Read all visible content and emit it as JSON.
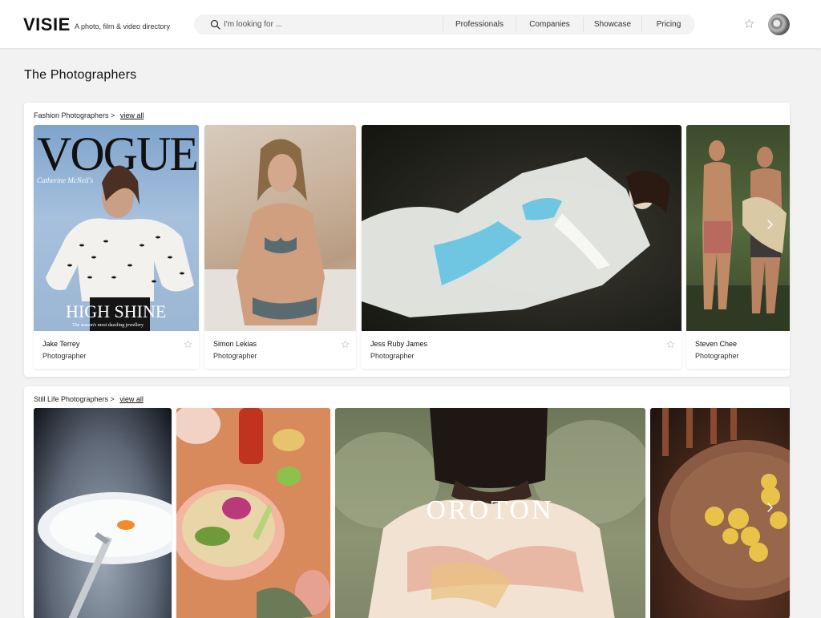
{
  "header": {
    "logo": "VISIE",
    "tagline": "A photo, film & video directory",
    "search_placeholder": "I'm looking for ...",
    "nav": [
      "Professionals",
      "Companies",
      "Showcase",
      "Pricing"
    ]
  },
  "page_title": "The Photographers",
  "sections": [
    {
      "heading": "Fashion Photographers >",
      "link": "view all",
      "cards": [
        {
          "name": "Jake Terrey",
          "role": "Photographer",
          "image_text": {
            "masthead": "VOGUE",
            "headline": "HIGH SHINE",
            "subline": "The season's most dazzling jewellery",
            "cover_name": "Catherine McNeil's"
          }
        },
        {
          "name": "Simon Lekias",
          "role": "Photographer"
        },
        {
          "name": "Jess Ruby James",
          "role": "Photographer"
        },
        {
          "name": "Steven Chee",
          "role": "Photographer"
        }
      ]
    },
    {
      "heading": "Still Life Photographers >",
      "link": "view all",
      "cards": [
        {
          "name": "",
          "role": ""
        },
        {
          "name": "",
          "role": ""
        },
        {
          "name": "",
          "role": "",
          "image_text": {
            "brand": "OROTON"
          }
        },
        {
          "name": "",
          "role": ""
        }
      ]
    }
  ],
  "icons": {
    "search": "search-icon",
    "favorite": "star-icon",
    "next": "chevron-right-icon"
  },
  "colors": {
    "background": "#f2f2f3",
    "card": "#ffffff",
    "text": "#1a1a1a"
  }
}
